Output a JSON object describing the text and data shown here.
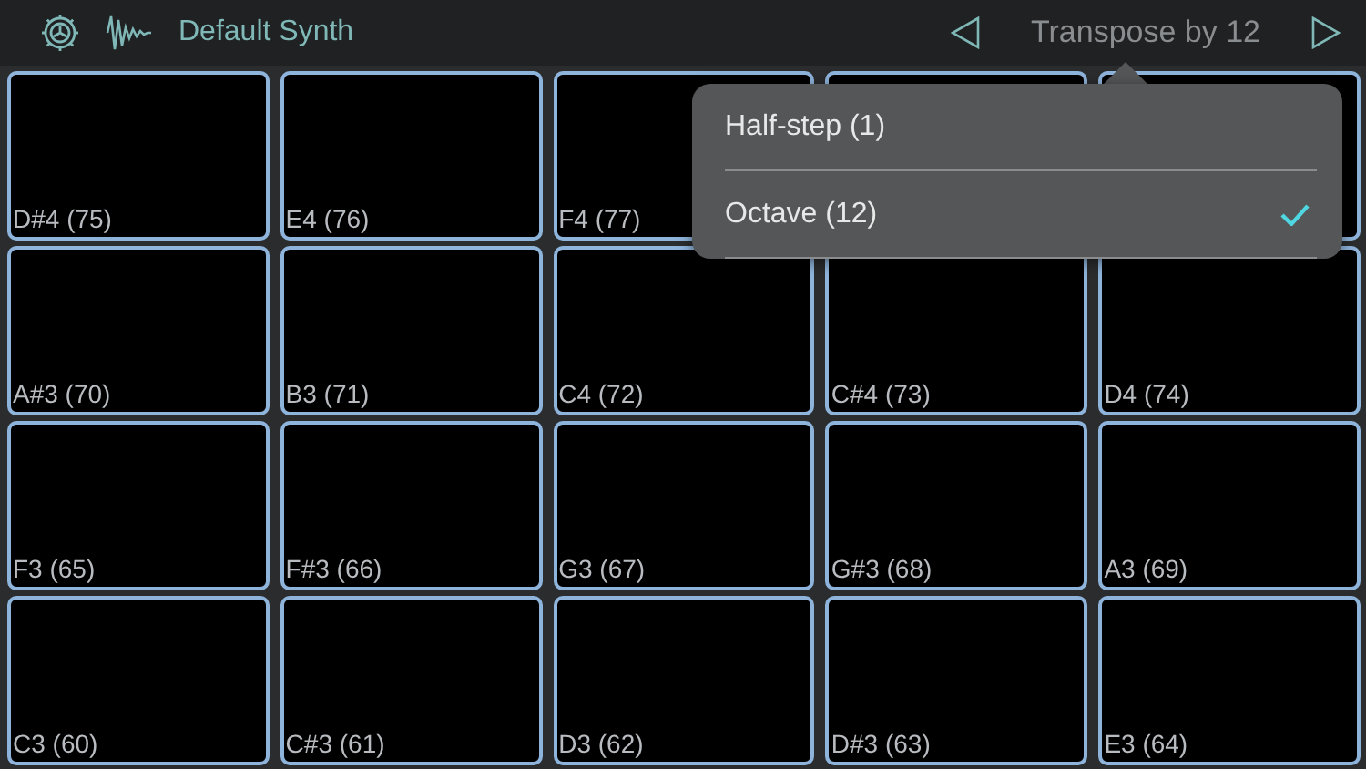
{
  "header": {
    "synth_name": "Default Synth",
    "transpose_label": "Transpose by 12"
  },
  "pad_rows": [
    [
      "D#4 (75)",
      "E4 (76)",
      "F4 (77)"
    ],
    [
      "A#3 (70)",
      "B3 (71)",
      "C4 (72)",
      "C#4 (73)",
      "D4 (74)"
    ],
    [
      "F3 (65)",
      "F#3 (66)",
      "G3 (67)",
      "G#3 (68)",
      "A3 (69)"
    ],
    [
      "C3 (60)",
      "C#3 (61)",
      "D3 (62)",
      "D#3 (63)",
      "E3 (64)"
    ]
  ],
  "popover": {
    "items": [
      {
        "label": "Half-step (1)",
        "selected": false
      },
      {
        "label": "Octave (12)",
        "selected": true
      }
    ]
  }
}
